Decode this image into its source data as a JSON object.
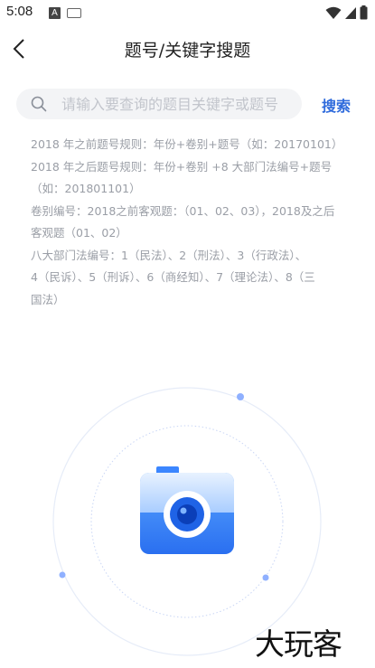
{
  "status_bar": {
    "time": "5:08",
    "icons": [
      "a-icon",
      "keyboard-icon",
      "wifi-icon",
      "signal-icon",
      "battery-icon"
    ]
  },
  "nav": {
    "title": "题号/关键字搜题",
    "back_icon": "chevron-left-icon"
  },
  "search": {
    "placeholder": "请输入要查询的题目关键字或题号",
    "button_label": "搜索",
    "value": ""
  },
  "rules": [
    "2018 年之前题号规则：年份+卷别+题号（如：20170101）",
    "2018 年之后题号规则：年份+卷别 +8 大部门法编号+题号",
    "（如：201801101）",
    "卷别编号：2018之前客观题：（01、02、03），2018及之后",
    "客观题（01、02）",
    "八大部门法编号：1（民法）、2（刑法）、3（行政法）、",
    "4（民诉）、5（刑诉）、6（商经知）、7（理论法）、8（三",
    "国法）"
  ],
  "camera": {
    "icon": "camera-icon",
    "accent": "#2f7bff",
    "ring_color": "#c9d6f5",
    "dot_color": "#8fb0ff"
  },
  "watermark": {
    "text": "大玩客"
  }
}
